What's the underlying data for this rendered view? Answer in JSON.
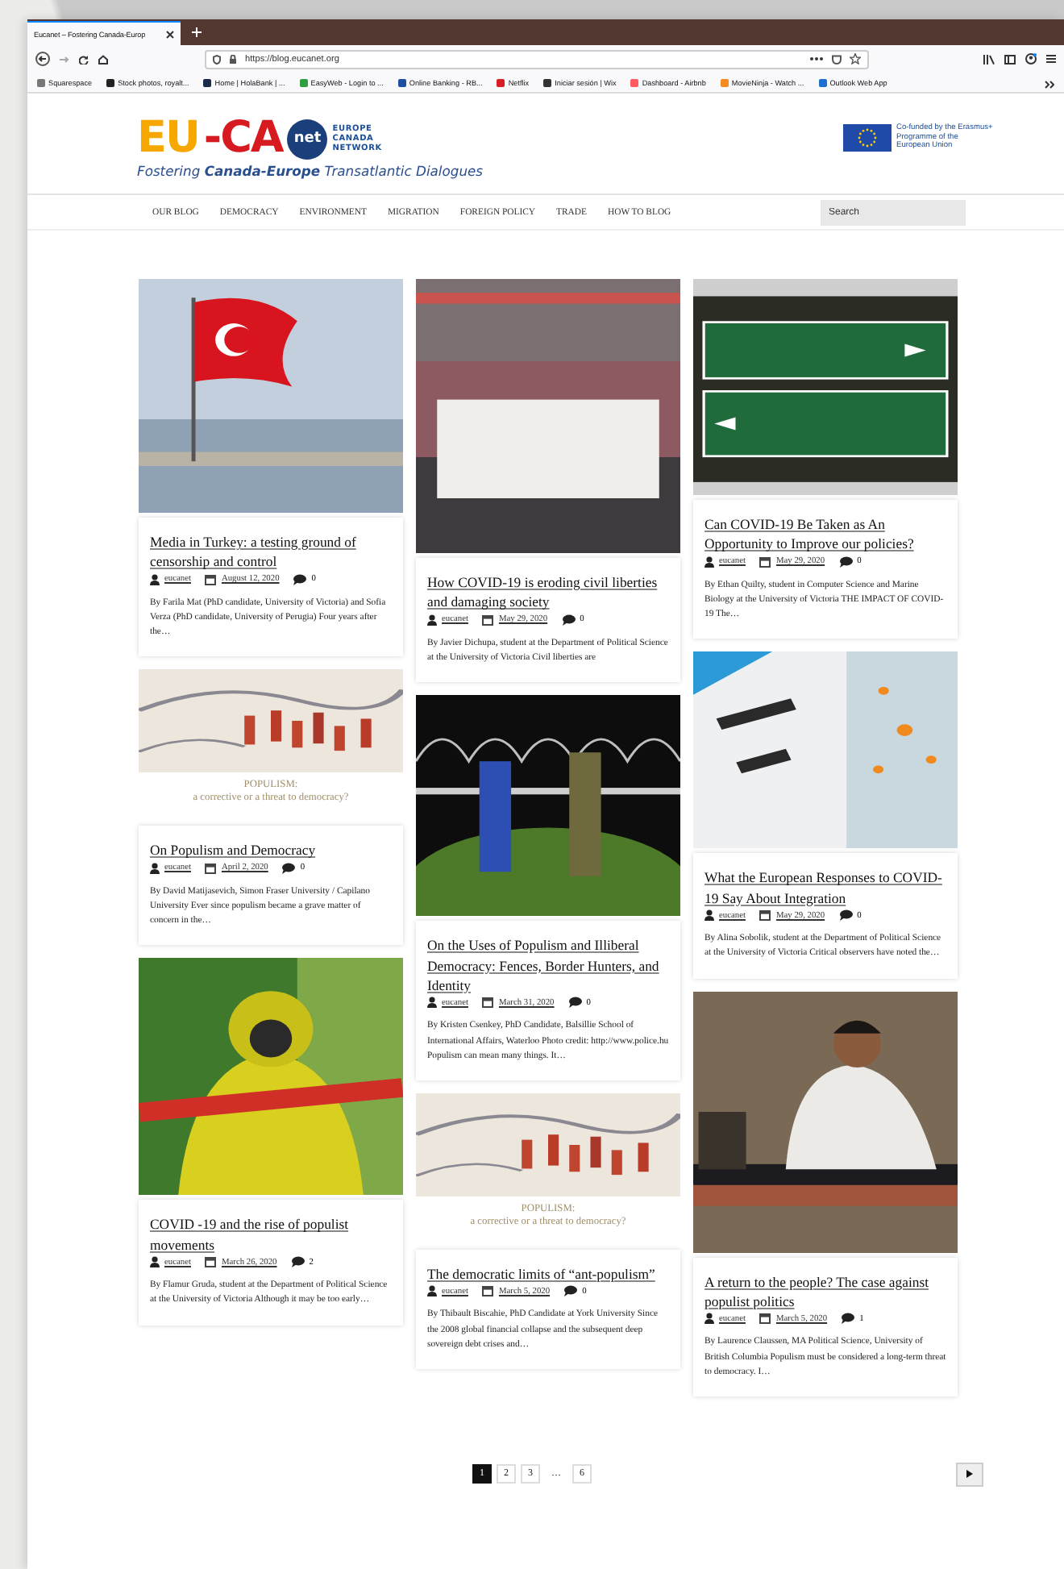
{
  "browser": {
    "tab_title": "Eucanet – Fostering Canada-Europ",
    "url": "https://blog.eucanet.org",
    "bookmarks": [
      {
        "label": "Squarespace",
        "color": "#777777"
      },
      {
        "label": "Stock photos, royalt...",
        "color": "#222222"
      },
      {
        "label": "Home | HolaBank | ...",
        "color": "#1a2a4a"
      },
      {
        "label": "EasyWeb - Login to ...",
        "color": "#2e9e3e"
      },
      {
        "label": "Online Banking - RB...",
        "color": "#1f4fa0"
      },
      {
        "label": "Netflix",
        "color": "#d81f26"
      },
      {
        "label": "Iniciar sesión | Wix",
        "color": "#333333"
      },
      {
        "label": "Dashboard - Airbnb",
        "color": "#ff5a5f"
      },
      {
        "label": "MovieNinja - Watch ...",
        "color": "#f58a1f"
      },
      {
        "label": "Outlook Web App",
        "color": "#1e6fd0"
      }
    ]
  },
  "header": {
    "logo": {
      "letters_1": "EU",
      "letters_2": "-CA",
      "badge": "net",
      "network": "EUROPE CANADA NETWORK",
      "tagline": "Fostering **Canada-Europe** Transatlantic Dialogues"
    },
    "funding": "Co-funded by the Erasmus+ Programme of the European Union"
  },
  "nav": {
    "items": [
      "OUR BLOG",
      "DEMOCRACY",
      "ENVIRONMENT",
      "MIGRATION",
      "FOREIGN POLICY",
      "TRADE",
      "HOW TO BLOG"
    ],
    "search": {
      "placeholder": "Search"
    }
  },
  "columns": [
    [
      {
        "title": "Media in Turkey: a testing ground of censorship and control",
        "author": "eucanet",
        "date": "August 12, 2020",
        "comments": "0",
        "excerpt": "By Farila Mat (PhD candidate, University of Victoria) and Sofia Verza (PhD candidate, University of Perugia) Four years after the…"
      },
      {
        "image_caption": {
          "heading": "POPULISM:",
          "subheading": "a corrective or a threat to democracy?"
        },
        "title": "On Populism and Democracy",
        "author": "eucanet",
        "date": "April 2, 2020",
        "comments": "0",
        "excerpt": "By David Matijasevich, Simon Fraser University / Capilano University Ever since populism became a grave matter of concern in the…"
      },
      {
        "title": "COVID -19 and the rise of populist movements",
        "author": "eucanet",
        "date": "March 26, 2020",
        "comments": "2",
        "excerpt": "By Flamur Gruda, student at the Department of Political Science at the University of Victoria Although it may be too early…"
      }
    ],
    [
      {
        "title": "How COVID-19 is eroding civil liberties and damaging society",
        "author": "eucanet",
        "date": "May 29, 2020",
        "comments": "0",
        "excerpt": "By Javier Dichupa, student at the Department of Political Science at the University of Victoria Civil liberties are"
      },
      {
        "title": "On the Uses of Populism and Illiberal Democracy: Fences, Border Hunters, and Identity",
        "author": "eucanet",
        "date": "March 31, 2020",
        "comments": "0",
        "excerpt": "By Kristen Csenkey, PhD Candidate, Balsillie School of International Affairs, Waterloo Photo credit: http://www.police.hu Populism can mean many things. It…"
      },
      {
        "image_caption": {
          "heading": "POPULISM:",
          "subheading": "a corrective or a threat to democracy?"
        },
        "title": "The democratic limits of “ant-populism”",
        "author": "eucanet",
        "date": "March 5, 2020",
        "comments": "0",
        "excerpt": "By Thibault Biscahie, PhD Candidate at York University Since the 2008 global financial collapse and the subsequent deep sovereign debt crises and…"
      }
    ],
    [
      {
        "title": "Can COVID-19 Be Taken as An Opportunity to Improve our policies?",
        "author": "eucanet",
        "date": "May 29, 2020",
        "comments": "0",
        "excerpt": "By Ethan Quilty, student in Computer Science and Marine Biology at the University of Victoria THE IMPACT OF COVID-19 The…"
      },
      {
        "title": "What the European Responses to COVID-19 Say About Integration",
        "author": "eucanet",
        "date": "May 29, 2020",
        "comments": "0",
        "excerpt": "By Alina Sobolik, student at the Department of Political Science at the University of Victoria Critical observers have noted the…"
      },
      {
        "title": "A return to the people? The case against populist politics",
        "author": "eucanet",
        "date": "March 5, 2020",
        "comments": "1",
        "excerpt": "By Laurence Claussen, MA Political Science, University of British Columbia Populism must be considered a long-term threat to democracy. I…"
      }
    ]
  ],
  "pagination": {
    "pages": [
      {
        "kind": "page",
        "label": "1",
        "selected": true
      },
      {
        "kind": "page",
        "label": "2",
        "selected": false
      },
      {
        "kind": "page",
        "label": "3",
        "selected": false
      },
      {
        "kind": "gap",
        "label": "…"
      },
      {
        "kind": "page",
        "label": "6",
        "selected": false
      }
    ]
  }
}
